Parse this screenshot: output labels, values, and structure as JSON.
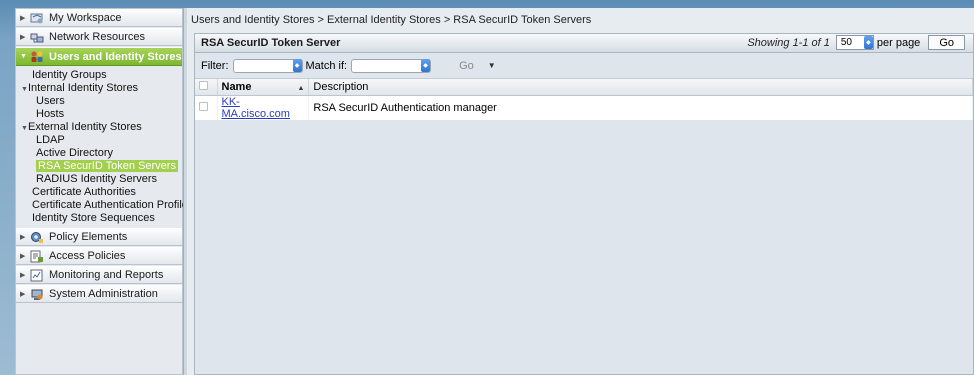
{
  "nav": {
    "drawers_top": [
      {
        "label": "My Workspace",
        "icon": "workspace-icon"
      },
      {
        "label": "Network Resources",
        "icon": "network-icon"
      }
    ],
    "active_drawer": {
      "label": "Users and Identity Stores",
      "icon": "users-icon"
    },
    "tree": [
      {
        "label": "Identity Groups"
      },
      {
        "label": "Internal Identity Stores"
      },
      {
        "label": "Users"
      },
      {
        "label": "Hosts"
      },
      {
        "label": "External Identity Stores"
      },
      {
        "label": "LDAP"
      },
      {
        "label": "Active Directory"
      },
      {
        "label": "RSA SecurID Token Servers"
      },
      {
        "label": "RADIUS Identity Servers"
      },
      {
        "label": "Certificate Authorities"
      },
      {
        "label": "Certificate Authentication Profile"
      },
      {
        "label": "Identity Store Sequences"
      }
    ],
    "drawers_bottom": [
      {
        "label": "Policy Elements",
        "icon": "policy-elements-icon"
      },
      {
        "label": "Access Policies",
        "icon": "access-policies-icon"
      },
      {
        "label": "Monitoring and Reports",
        "icon": "monitoring-icon"
      },
      {
        "label": "System Administration",
        "icon": "system-admin-icon"
      }
    ]
  },
  "breadcrumb": "Users and Identity Stores > External Identity Stores > RSA SecurID Token Servers",
  "panel": {
    "title": "RSA SecurID Token Server",
    "showing": "Showing 1-1 of 1",
    "per_page_value": "50",
    "per_page_label": "per page",
    "go_label": "Go"
  },
  "filter": {
    "filter_label": "Filter:",
    "match_label": "Match if:",
    "go_label": "Go"
  },
  "table": {
    "columns": [
      "Name",
      "Description"
    ],
    "rows": [
      {
        "name": "KK-MA.cisco.com",
        "description": "RSA SecurID Authentication manager"
      }
    ]
  },
  "colors": {
    "active_drawer": "#8cc63f",
    "link": "#2a3bc2",
    "spinner": "#3b82dc"
  }
}
